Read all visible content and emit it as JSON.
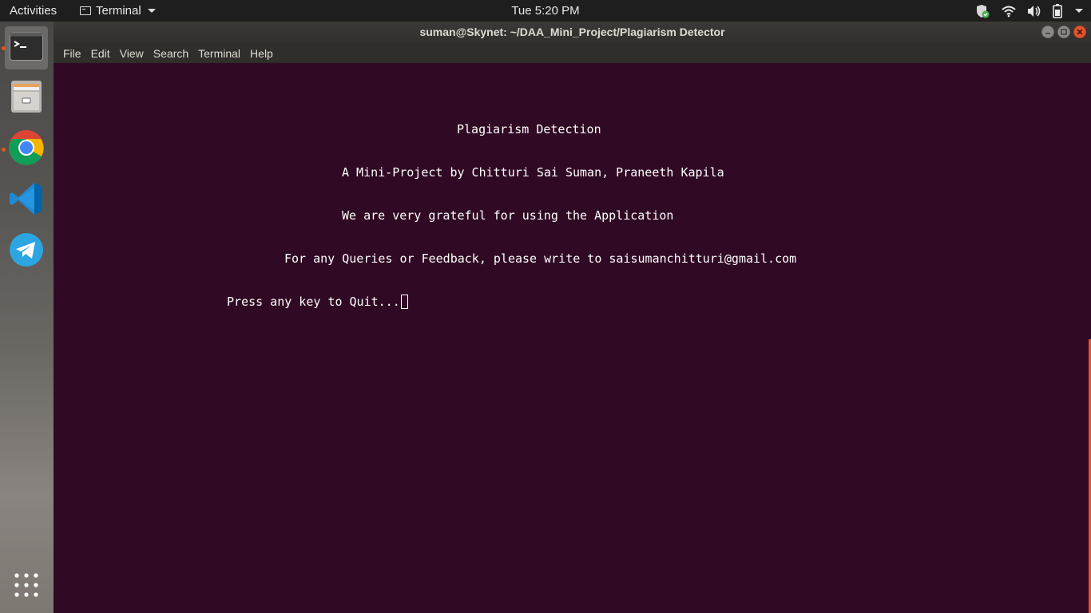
{
  "topbar": {
    "activities": "Activities",
    "app_menu": "Terminal",
    "clock": "Tue  5:20 PM"
  },
  "dock": {
    "items": [
      "terminal-icon",
      "files-icon",
      "chrome-icon",
      "vscode-icon",
      "telegram-icon",
      "app-grid-icon"
    ]
  },
  "window": {
    "title": "suman@Skynet: ~/DAA_Mini_Project/Plagiarism Detector",
    "menu": [
      "File",
      "Edit",
      "View",
      "Search",
      "Terminal",
      "Help"
    ]
  },
  "terminal": {
    "background": "#300a24",
    "lines": [
      "Plagiarism Detection",
      "A Mini-Project by Chitturi Sai Suman, Praneeth Kapila",
      "We are very grateful for using the Application",
      "For any Queries or Feedback, please write to saisumanchitturi@gmail.com",
      "Press any key to Quit..."
    ]
  },
  "colors": {
    "accent": "#e95420",
    "topbar": "#1e1e1e",
    "titlebar": "#3b3a37"
  }
}
